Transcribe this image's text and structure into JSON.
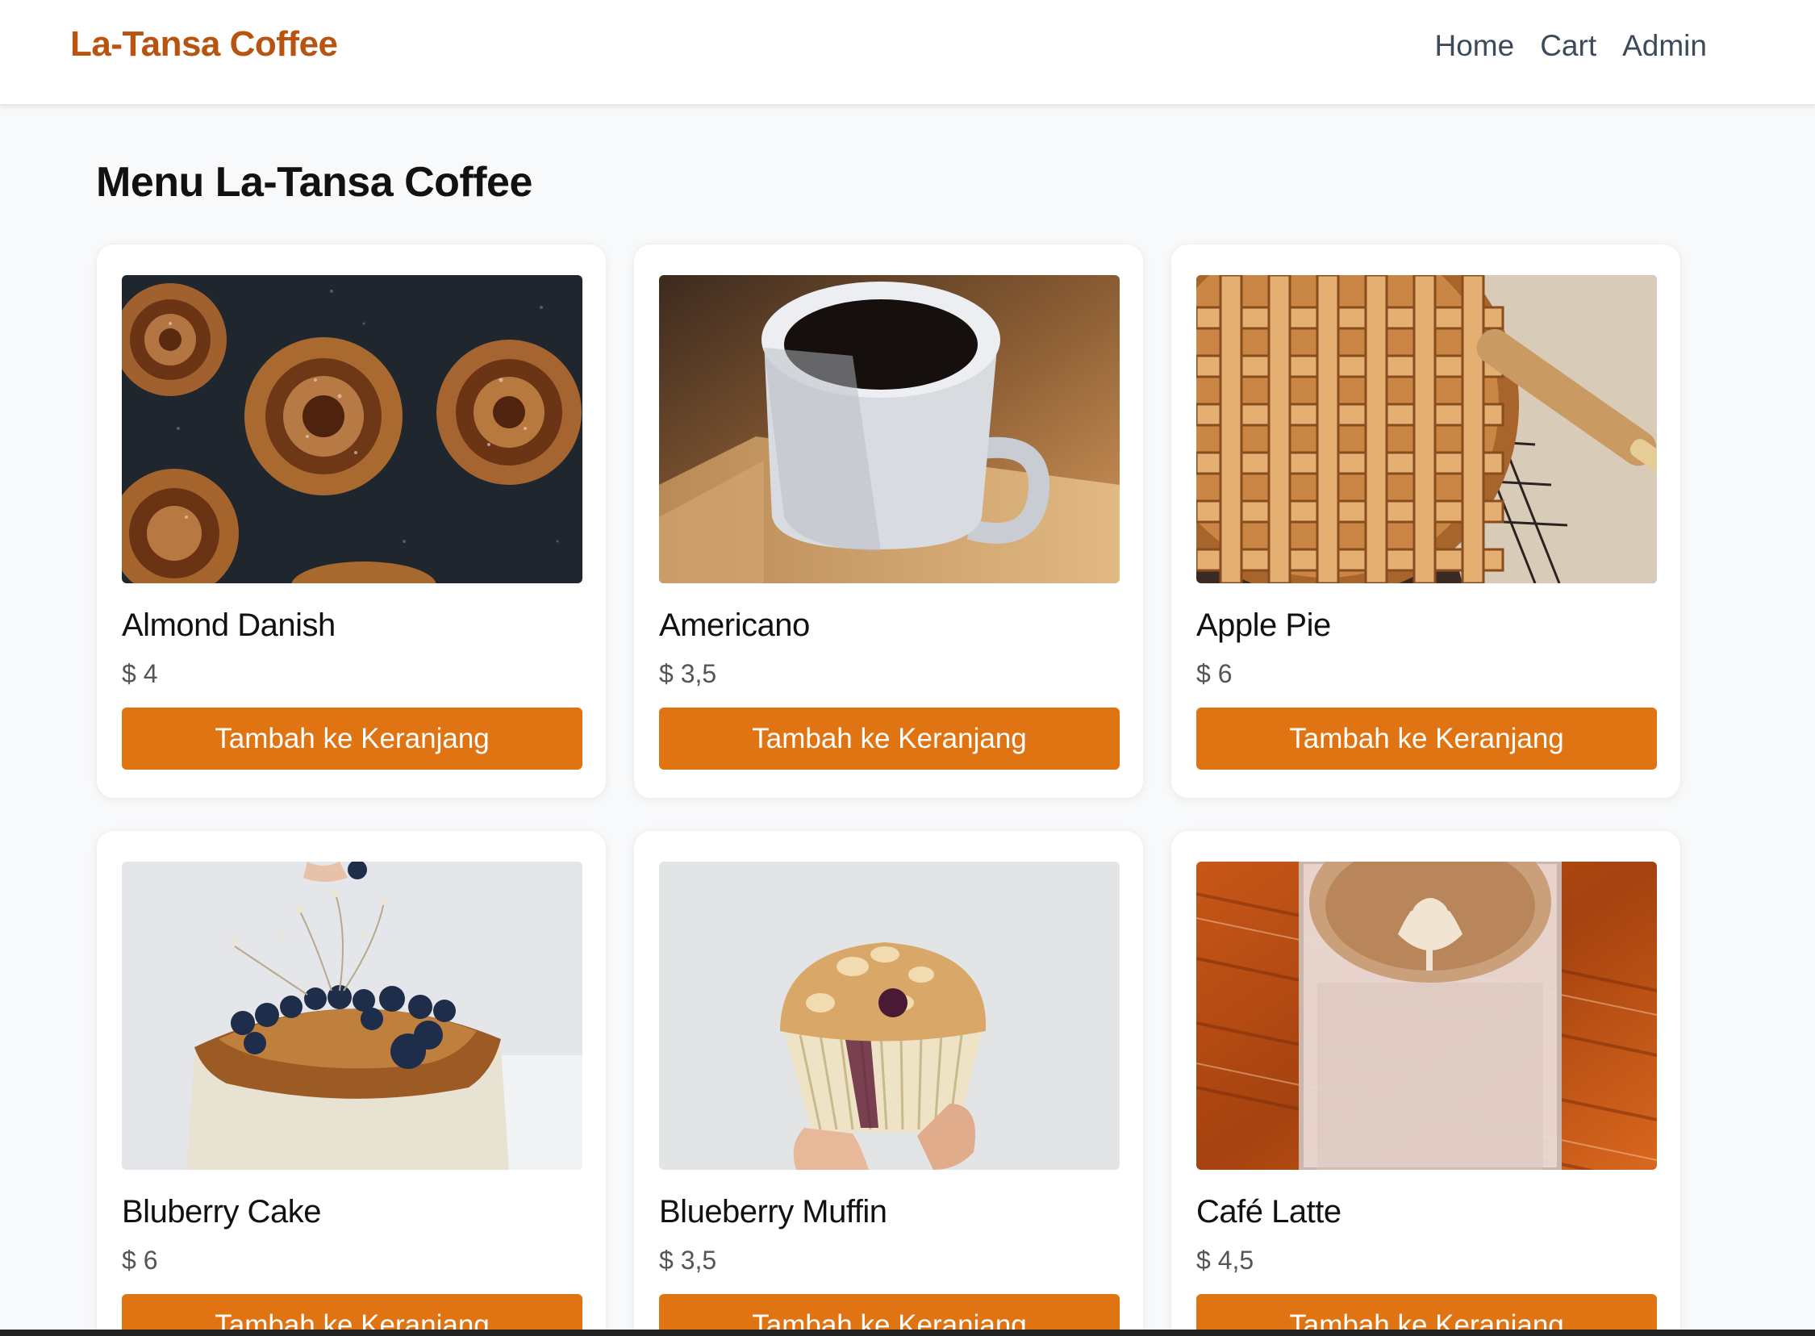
{
  "navbar": {
    "brand": "La-Tansa Coffee",
    "links": [
      "Home",
      "Cart",
      "Admin"
    ]
  },
  "page": {
    "title": "Menu La-Tansa Coffee"
  },
  "products": [
    {
      "name": "Almond Danish",
      "price": "$ 4",
      "button": "Tambah ke Keranjang",
      "image": "cinnamon-rolls"
    },
    {
      "name": "Americano",
      "price": "$ 3,5",
      "button": "Tambah ke Keranjang",
      "image": "coffee-cup"
    },
    {
      "name": "Apple Pie",
      "price": "$ 6",
      "button": "Tambah ke Keranjang",
      "image": "lattice-pie"
    },
    {
      "name": "Bluberry Cake",
      "price": "$ 6",
      "button": "Tambah ke Keranjang",
      "image": "blueberry-cake"
    },
    {
      "name": "Blueberry Muffin",
      "price": "$ 3,5",
      "button": "Tambah ke Keranjang",
      "image": "muffin"
    },
    {
      "name": "Café Latte",
      "price": "$ 4,5",
      "button": "Tambah ke Keranjang",
      "image": "latte"
    }
  ],
  "colors": {
    "brand": "#b8540f",
    "button": "#e07412",
    "background": "#f8f9fa"
  }
}
